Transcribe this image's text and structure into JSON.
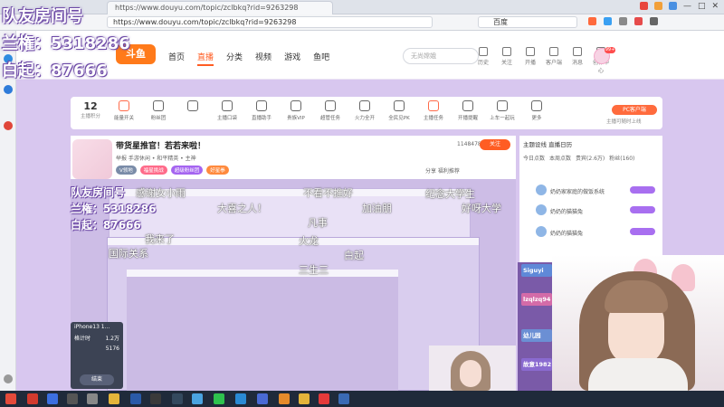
{
  "overlay": {
    "room_title": "队友房间号",
    "lanquan": "兰権：5318286",
    "baiqi": "白起：87666"
  },
  "browser": {
    "url": "https://www.douyu.com/topic/zclbkq?rid=9263298",
    "search_engine": "百度"
  },
  "header": {
    "logo": "斗鱼",
    "nav": [
      "首页",
      "直播",
      "分类",
      "视频",
      "游戏",
      "鱼吧"
    ],
    "search_placeholder": "无尚嫦娥",
    "icons": [
      "历史",
      "关注",
      "开播",
      "客户端",
      "消息",
      "创作中心"
    ],
    "badge": "99+"
  },
  "toolbar": {
    "count": "12",
    "count_label": "主播积分",
    "items": [
      "能量开关",
      "粉丝团",
      "",
      "主播口袋",
      "直播助手",
      "贵族VIP",
      "超管任务",
      "火力全开",
      "全民见PK",
      "主播任务",
      "开播提醒",
      "上车一起玩",
      "更多"
    ],
    "pc_button": "PC客户端",
    "pc_sub": "主播可随时上线"
  },
  "room": {
    "title": "带货星推官！若若来啦！",
    "meta": "举报   手游休闲 • 和平精英 • 主神",
    "fans": "1148478",
    "follow": "关注",
    "tags": [
      "V领地",
      "福星挑战",
      "超级粉丝团",
      "好星拳"
    ],
    "share": "分享   福利推荐"
  },
  "right_panel": {
    "tabs": "主题设线   直播日历",
    "sub": [
      "今日点数",
      "本周点数",
      "贵宾(2.6万)",
      "粉丝(160)"
    ],
    "rows": [
      "奶奶家家庭的做饭系统",
      "奶奶的猫猫兔",
      "奶奶的猫猫兔"
    ],
    "note": "本房间粉丝福利活动开启 ..."
  },
  "chat_strip": [
    "Siguyi",
    "lzqlzq94",
    "幼儿园",
    "故意1982"
  ],
  "danmu": [
    "感谢女小雨",
    "大喜之人！",
    "纪念大学生",
    "加油朋",
    "不看不推好",
    "凡事",
    "我来了",
    "火龙",
    "国际关系",
    "好呀大学",
    "白起",
    "三生三"
  ],
  "phone": {
    "title": "iPhone13 1...",
    "row1_l": "格计时",
    "row1_r": "1.2万",
    "row2_l": "",
    "row2_r": "5176",
    "end": "结束"
  }
}
